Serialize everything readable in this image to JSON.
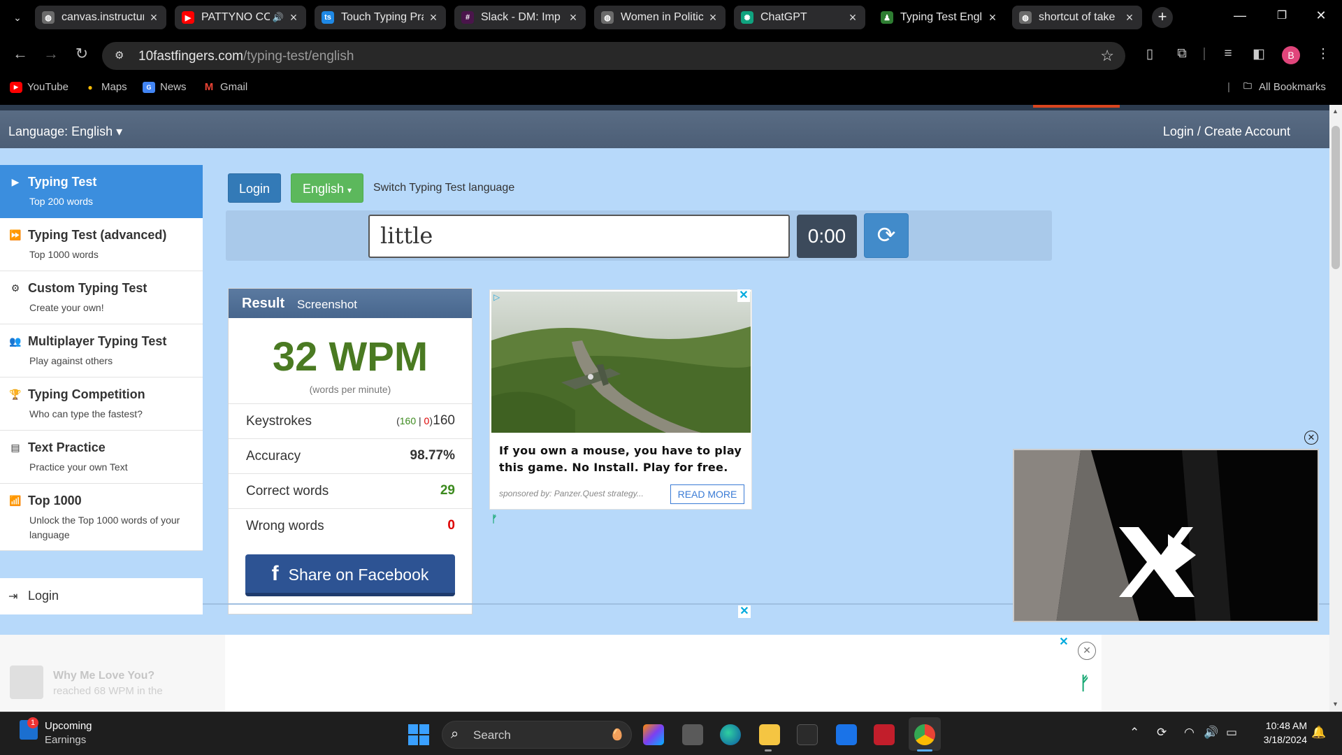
{
  "browser": {
    "tabs": [
      {
        "title": "canvas.instructure",
        "favicon": "globe-icon",
        "color": "#6b6b6b"
      },
      {
        "title": "PATTYNO CO",
        "favicon": "youtube-icon",
        "color": "#ff0000",
        "audio": true
      },
      {
        "title": "Touch Typing Pra",
        "favicon": "ts-icon",
        "color": "#1e88e5"
      },
      {
        "title": "Slack - DM: Imp",
        "favicon": "slack-icon",
        "color": "#4a154b"
      },
      {
        "title": "Women in Politic",
        "favicon": "globe-icon",
        "color": "#6b6b6b"
      },
      {
        "title": "ChatGPT",
        "favicon": "chatgpt-icon",
        "color": "#10a37f"
      },
      {
        "title": "Typing Test Engl",
        "favicon": "10ff-icon",
        "color": "#2e7d32",
        "active": true
      },
      {
        "title": "shortcut of take",
        "favicon": "globe-icon",
        "color": "#6b6b6b"
      }
    ],
    "url_host": "10fastfingers.com",
    "url_path": "/typing-test/english",
    "profile_initial": "B",
    "bookmarks": [
      {
        "label": "YouTube",
        "icon": "youtube-icon"
      },
      {
        "label": "Maps",
        "icon": "maps-icon"
      },
      {
        "label": "News",
        "icon": "news-icon"
      },
      {
        "label": "Gmail",
        "icon": "gmail-icon"
      }
    ],
    "all_bookmarks": "All Bookmarks"
  },
  "site": {
    "language_menu": "Language: English",
    "account_link": "Login / Create Account",
    "login_button": "Login",
    "language_button": "English",
    "switch_label": "Switch Typing Test language",
    "current_word": "little",
    "timer": "0:00"
  },
  "menu": [
    {
      "title": "Typing Test",
      "sub": "Top 200 words",
      "icon": "play-icon",
      "active": true
    },
    {
      "title": "Typing Test (advanced)",
      "sub": "Top 1000 words",
      "icon": "fast-forward-icon"
    },
    {
      "title": "Custom Typing Test",
      "sub": "Create your own!",
      "icon": "cogs-icon"
    },
    {
      "title": "Multiplayer Typing Test",
      "sub": "Play against others",
      "icon": "users-icon"
    },
    {
      "title": "Typing Competition",
      "sub": "Who can type the fastest?",
      "icon": "trophy-icon"
    },
    {
      "title": "Text Practice",
      "sub": "Practice your own Text",
      "icon": "document-icon"
    },
    {
      "title": "Top 1000",
      "sub": "Unlock the Top 1000 words of your language",
      "icon": "signal-icon"
    }
  ],
  "menu_login": "Login",
  "result": {
    "title": "Result",
    "screenshot_link": "Screenshot",
    "wpm": "32 WPM",
    "wpm_sub": "(words per minute)",
    "keystrokes_label": "Keystrokes",
    "keystrokes_correct": "160",
    "keystrokes_wrong": "0",
    "keystrokes_total": "160",
    "accuracy_label": "Accuracy",
    "accuracy": "98.77%",
    "correct_label": "Correct words",
    "correct": "29",
    "wrong_label": "Wrong words",
    "wrong": "0",
    "share": "Share on Facebook"
  },
  "ad": {
    "text": "If you own a mouse, you have to play this game. No Install. Play for free.",
    "sponsor": "sponsored by: Panzer.Quest strategy...",
    "cta": "READ MORE"
  },
  "faded_notice": {
    "title": "Why Me Love You?",
    "line": "reached 68 WPM in the"
  },
  "taskbar": {
    "weather_title": "Upcoming",
    "weather_sub": "Earnings",
    "badge": "1",
    "search": "Search",
    "time": "10:48 AM",
    "date": "3/18/2024"
  }
}
